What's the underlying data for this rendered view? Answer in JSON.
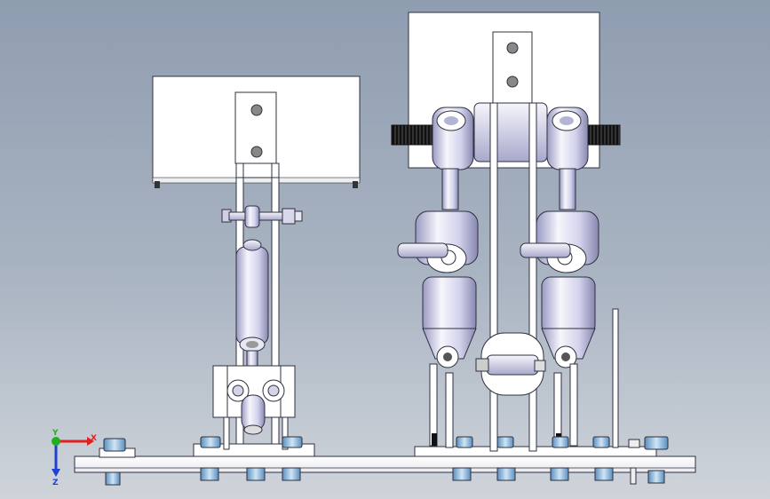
{
  "viewport": {
    "background_top": "#8f9db0",
    "background_bottom": "#cfd4da"
  },
  "triad": {
    "x_label": "X",
    "y_label": "Y",
    "z_label": "Z",
    "x_color": "#e02020",
    "y_color": "#20b020",
    "z_color": "#2040d0"
  },
  "colors": {
    "plate_fill": "#ffffff",
    "line": "#303040",
    "chrome_light": "#f4f4fb",
    "chrome_mid": "#c8c8e6",
    "chrome_dark": "#8c8cb4",
    "bolt_blue": "#7fb2d8",
    "thread_black": "#1a1a1a"
  }
}
